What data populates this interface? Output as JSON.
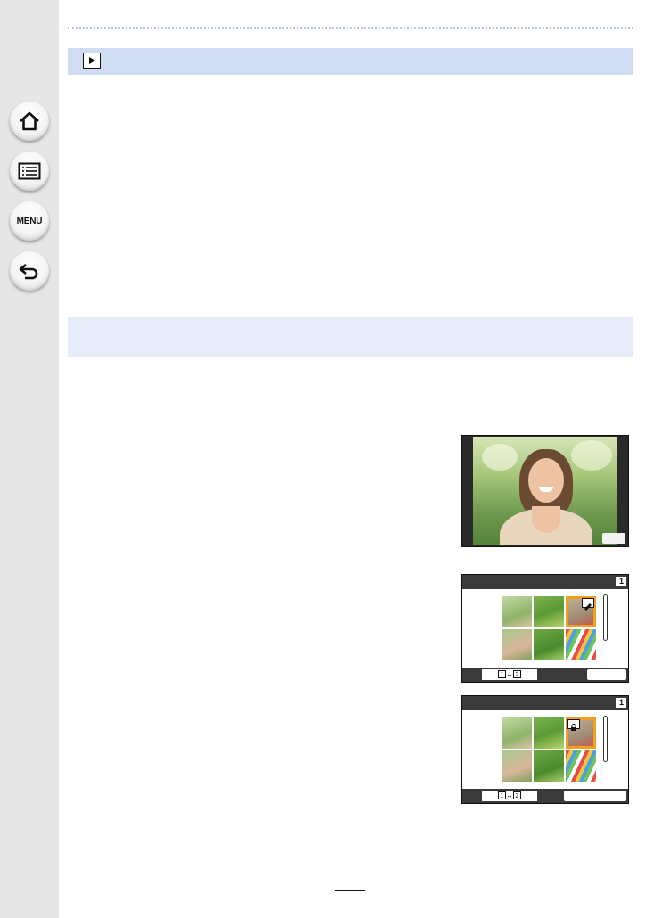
{
  "sidebar": {
    "home_icon": "home-icon",
    "toc_icon": "list-icon",
    "menu_label": "MENU",
    "back_icon": "back-arrow-icon"
  },
  "header": {
    "mode_icon": "playback-icon"
  },
  "screens": [
    {
      "name": "playback-photo-screen",
      "badge": ""
    },
    {
      "name": "thumbnail-grid-screen-1",
      "page_number": "1",
      "swap_left": "1",
      "swap_right": "2",
      "mark_icon": "edit-icon"
    },
    {
      "name": "thumbnail-grid-screen-2",
      "page_number": "1",
      "swap_left": "1",
      "swap_right": "2",
      "mark_icon": "lock-icon"
    }
  ],
  "colors": {
    "sidebar_bg": "#e6e6e6",
    "section_bar": "#cfdcf1",
    "section_bar_light": "#e6edf8",
    "highlight": "#f0a020"
  }
}
